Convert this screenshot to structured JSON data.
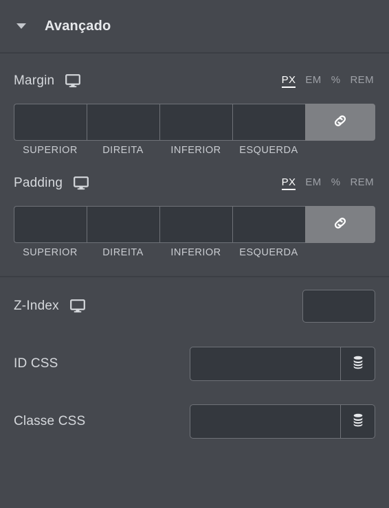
{
  "section": {
    "title": "Avançado",
    "collapse_icon": "chevron-down-icon",
    "expanded": true
  },
  "colors": {
    "panel_bg": "#45484e",
    "input_bg": "#34383e",
    "input_border": "#6f7278",
    "divider": "#3b3e44",
    "label_text": "#d5d8dc",
    "active_unit": "#ffffff",
    "inactive_unit": "#9ea1a7",
    "link_button_bg": "#7e8084"
  },
  "units": [
    {
      "label": "PX",
      "active": true
    },
    {
      "label": "EM",
      "active": false
    },
    {
      "label": "%",
      "active": false
    },
    {
      "label": "REM",
      "active": false
    }
  ],
  "dimension_labels": [
    "SUPERIOR",
    "DIREITA",
    "INFERIOR",
    "ESQUERDA"
  ],
  "margin": {
    "label": "Margin",
    "device_icon": "desktop-monitor-icon",
    "link_icon": "link-chain-icon",
    "link_active": true,
    "values": {
      "top": "",
      "right": "",
      "bottom": "",
      "left": ""
    },
    "placeholders": {
      "top": "",
      "right": "",
      "bottom": "",
      "left": ""
    }
  },
  "padding": {
    "label": "Padding",
    "device_icon": "desktop-monitor-icon",
    "link_icon": "link-chain-icon",
    "link_active": true,
    "values": {
      "top": "",
      "right": "",
      "bottom": "",
      "left": ""
    },
    "placeholders": {
      "top": "",
      "right": "",
      "bottom": "",
      "left": ""
    }
  },
  "z_index": {
    "label": "Z-Index",
    "device_icon": "desktop-monitor-icon",
    "value": "",
    "placeholder": ""
  },
  "css_id": {
    "label": "ID CSS",
    "value": "",
    "placeholder": "",
    "dynamic_icon": "database-stack-icon"
  },
  "css_class": {
    "label": "Classe CSS",
    "value": "",
    "placeholder": "",
    "dynamic_icon": "database-stack-icon"
  }
}
